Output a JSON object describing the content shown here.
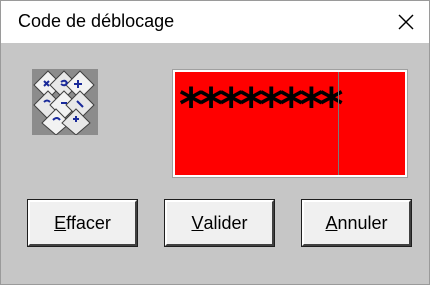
{
  "window": {
    "title": "Code de déblocage",
    "close_icon": "close-icon"
  },
  "icon": {
    "name": "keyboard-keys-icon"
  },
  "code_field": {
    "value": "********",
    "background_color": "#ff0000"
  },
  "buttons": {
    "effacer": {
      "mnemonic": "E",
      "rest": "ffacer"
    },
    "valider": {
      "mnemonic": "V",
      "rest": "alider"
    },
    "annuler": {
      "mnemonic": "A",
      "rest": "nnuler"
    }
  }
}
